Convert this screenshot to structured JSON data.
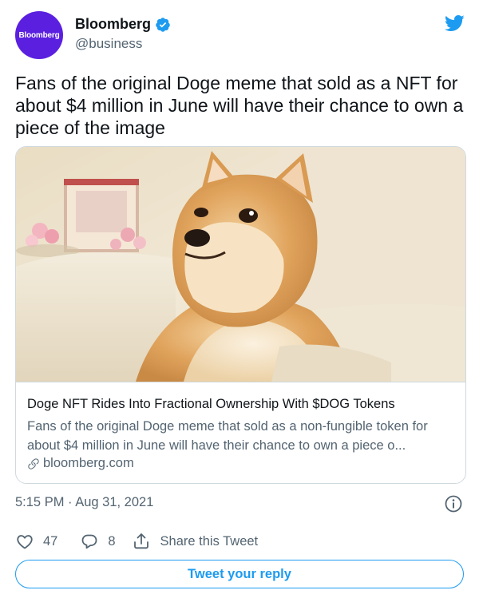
{
  "author": {
    "avatar_text": "Bloomberg",
    "display_name": "Bloomberg",
    "handle": "@business",
    "verified": true
  },
  "tweet": {
    "text": "Fans of the original Doge meme that sold as a NFT for about $4 million in June will have their chance to own a piece of the image"
  },
  "card": {
    "title": "Doge NFT Rides Into Fractional Ownership With $DOG Tokens",
    "description": "Fans of the original Doge meme that sold as a non-fungible token for about $4 million in June will have their chance to own a piece o...",
    "domain": "bloomberg.com"
  },
  "meta": {
    "timestamp": "5:15 PM · Aug 31, 2021"
  },
  "actions": {
    "like_count": "47",
    "reply_count": "8",
    "share_label": "Share this Tweet",
    "reply_button_label": "Tweet your reply"
  },
  "icons": {
    "brand": "twitter-bird-icon",
    "verified": "verified-badge-icon",
    "info": "info-icon",
    "like": "heart-icon",
    "reply": "reply-bubble-icon",
    "share": "share-icon",
    "link": "link-icon"
  },
  "colors": {
    "accent": "#1d9bf0",
    "avatar_bg": "#5b1fe0",
    "text_primary": "#0f1419",
    "text_secondary": "#536471",
    "border": "#cfd9de"
  }
}
